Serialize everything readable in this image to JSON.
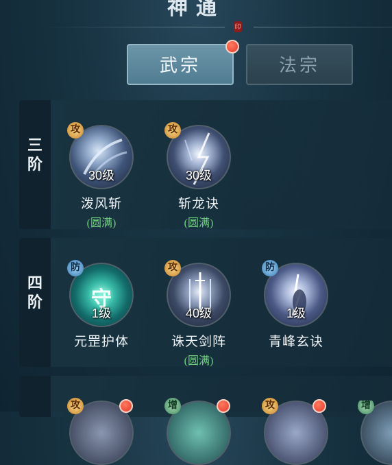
{
  "header": {
    "title": "神通",
    "seal_text": "印"
  },
  "tabs": [
    {
      "label": "武宗",
      "active": true
    },
    {
      "label": "法宗",
      "active": false
    }
  ],
  "tiers": [
    {
      "label_line1": "三",
      "label_line2": "阶",
      "skills": [
        {
          "name": "泼风斩",
          "level": "30级",
          "status": "(圆满)",
          "badge": "攻",
          "badge_type": "attack"
        },
        {
          "name": "斩龙诀",
          "level": "30级",
          "status": "(圆满)",
          "badge": "攻",
          "badge_type": "attack"
        }
      ]
    },
    {
      "label_line1": "四",
      "label_line2": "阶",
      "skills": [
        {
          "name": "元罡护体",
          "level": "1级",
          "status": "",
          "badge": "防",
          "badge_type": "defense",
          "icon_glyph": "守"
        },
        {
          "name": "诛天剑阵",
          "level": "40级",
          "status": "(圆满)",
          "badge": "攻",
          "badge_type": "attack"
        },
        {
          "name": "青峰玄诀",
          "level": "1级",
          "status": "",
          "badge": "防",
          "badge_type": "defense"
        }
      ]
    },
    {
      "skills": [
        {
          "badge": "攻",
          "badge_type": "attack"
        },
        {
          "badge": "增",
          "badge_type": "buff"
        },
        {
          "badge": "攻",
          "badge_type": "attack"
        },
        {
          "badge": "增",
          "badge_type": "buff"
        }
      ]
    }
  ],
  "colors": {
    "accent_red": "#e33a2a",
    "status_green": "#6fcf7e",
    "tab_active": "#507c92"
  }
}
